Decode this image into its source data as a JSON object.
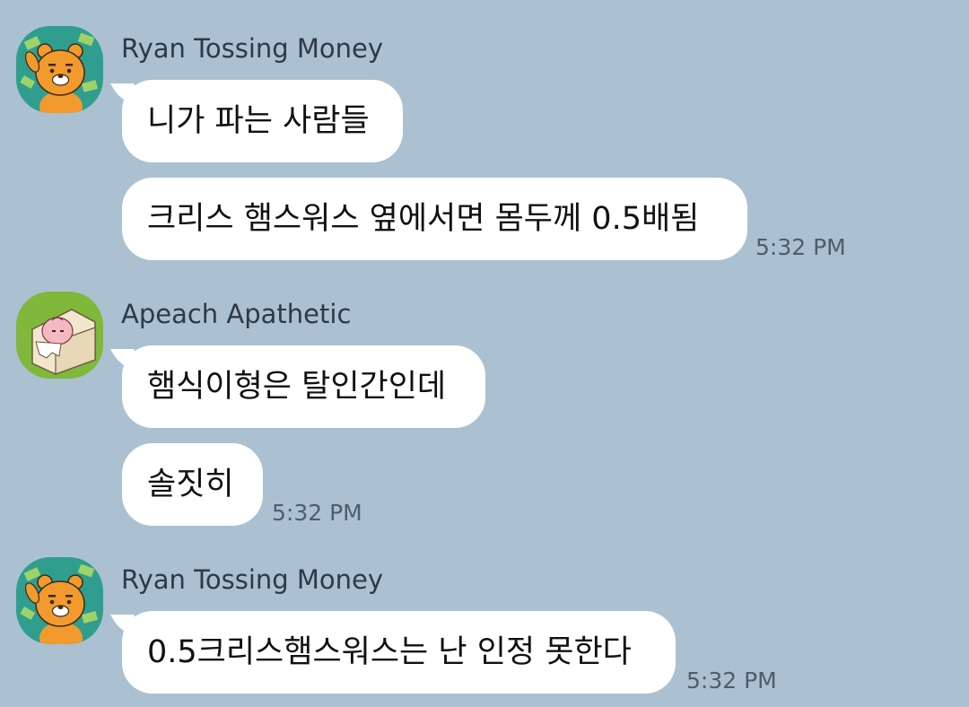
{
  "messages": [
    {
      "sender": "Ryan Tossing Money",
      "avatar_icon": "ryan-tossing-money-avatar",
      "bubbles": [
        "니가 파는 사람들",
        "크리스 햄스워스 옆에서면 몸두께 0.5배됨"
      ],
      "time": "5:32 PM"
    },
    {
      "sender": "Apeach Apathetic",
      "avatar_icon": "apeach-apathetic-avatar",
      "bubbles": [
        "햄식이형은 탈인간인데",
        "솔짓히"
      ],
      "time": "5:32 PM"
    },
    {
      "sender": "Ryan Tossing Money",
      "avatar_icon": "ryan-tossing-money-avatar",
      "bubbles": [
        "0.5크리스햄스워스는 난 인정 못한다"
      ],
      "time": "5:32 PM"
    }
  ],
  "colors": {
    "background": "#abc1d1",
    "bubble": "#ffffff",
    "sender_text": "#2e3a44",
    "time_text": "#4f5d69"
  }
}
